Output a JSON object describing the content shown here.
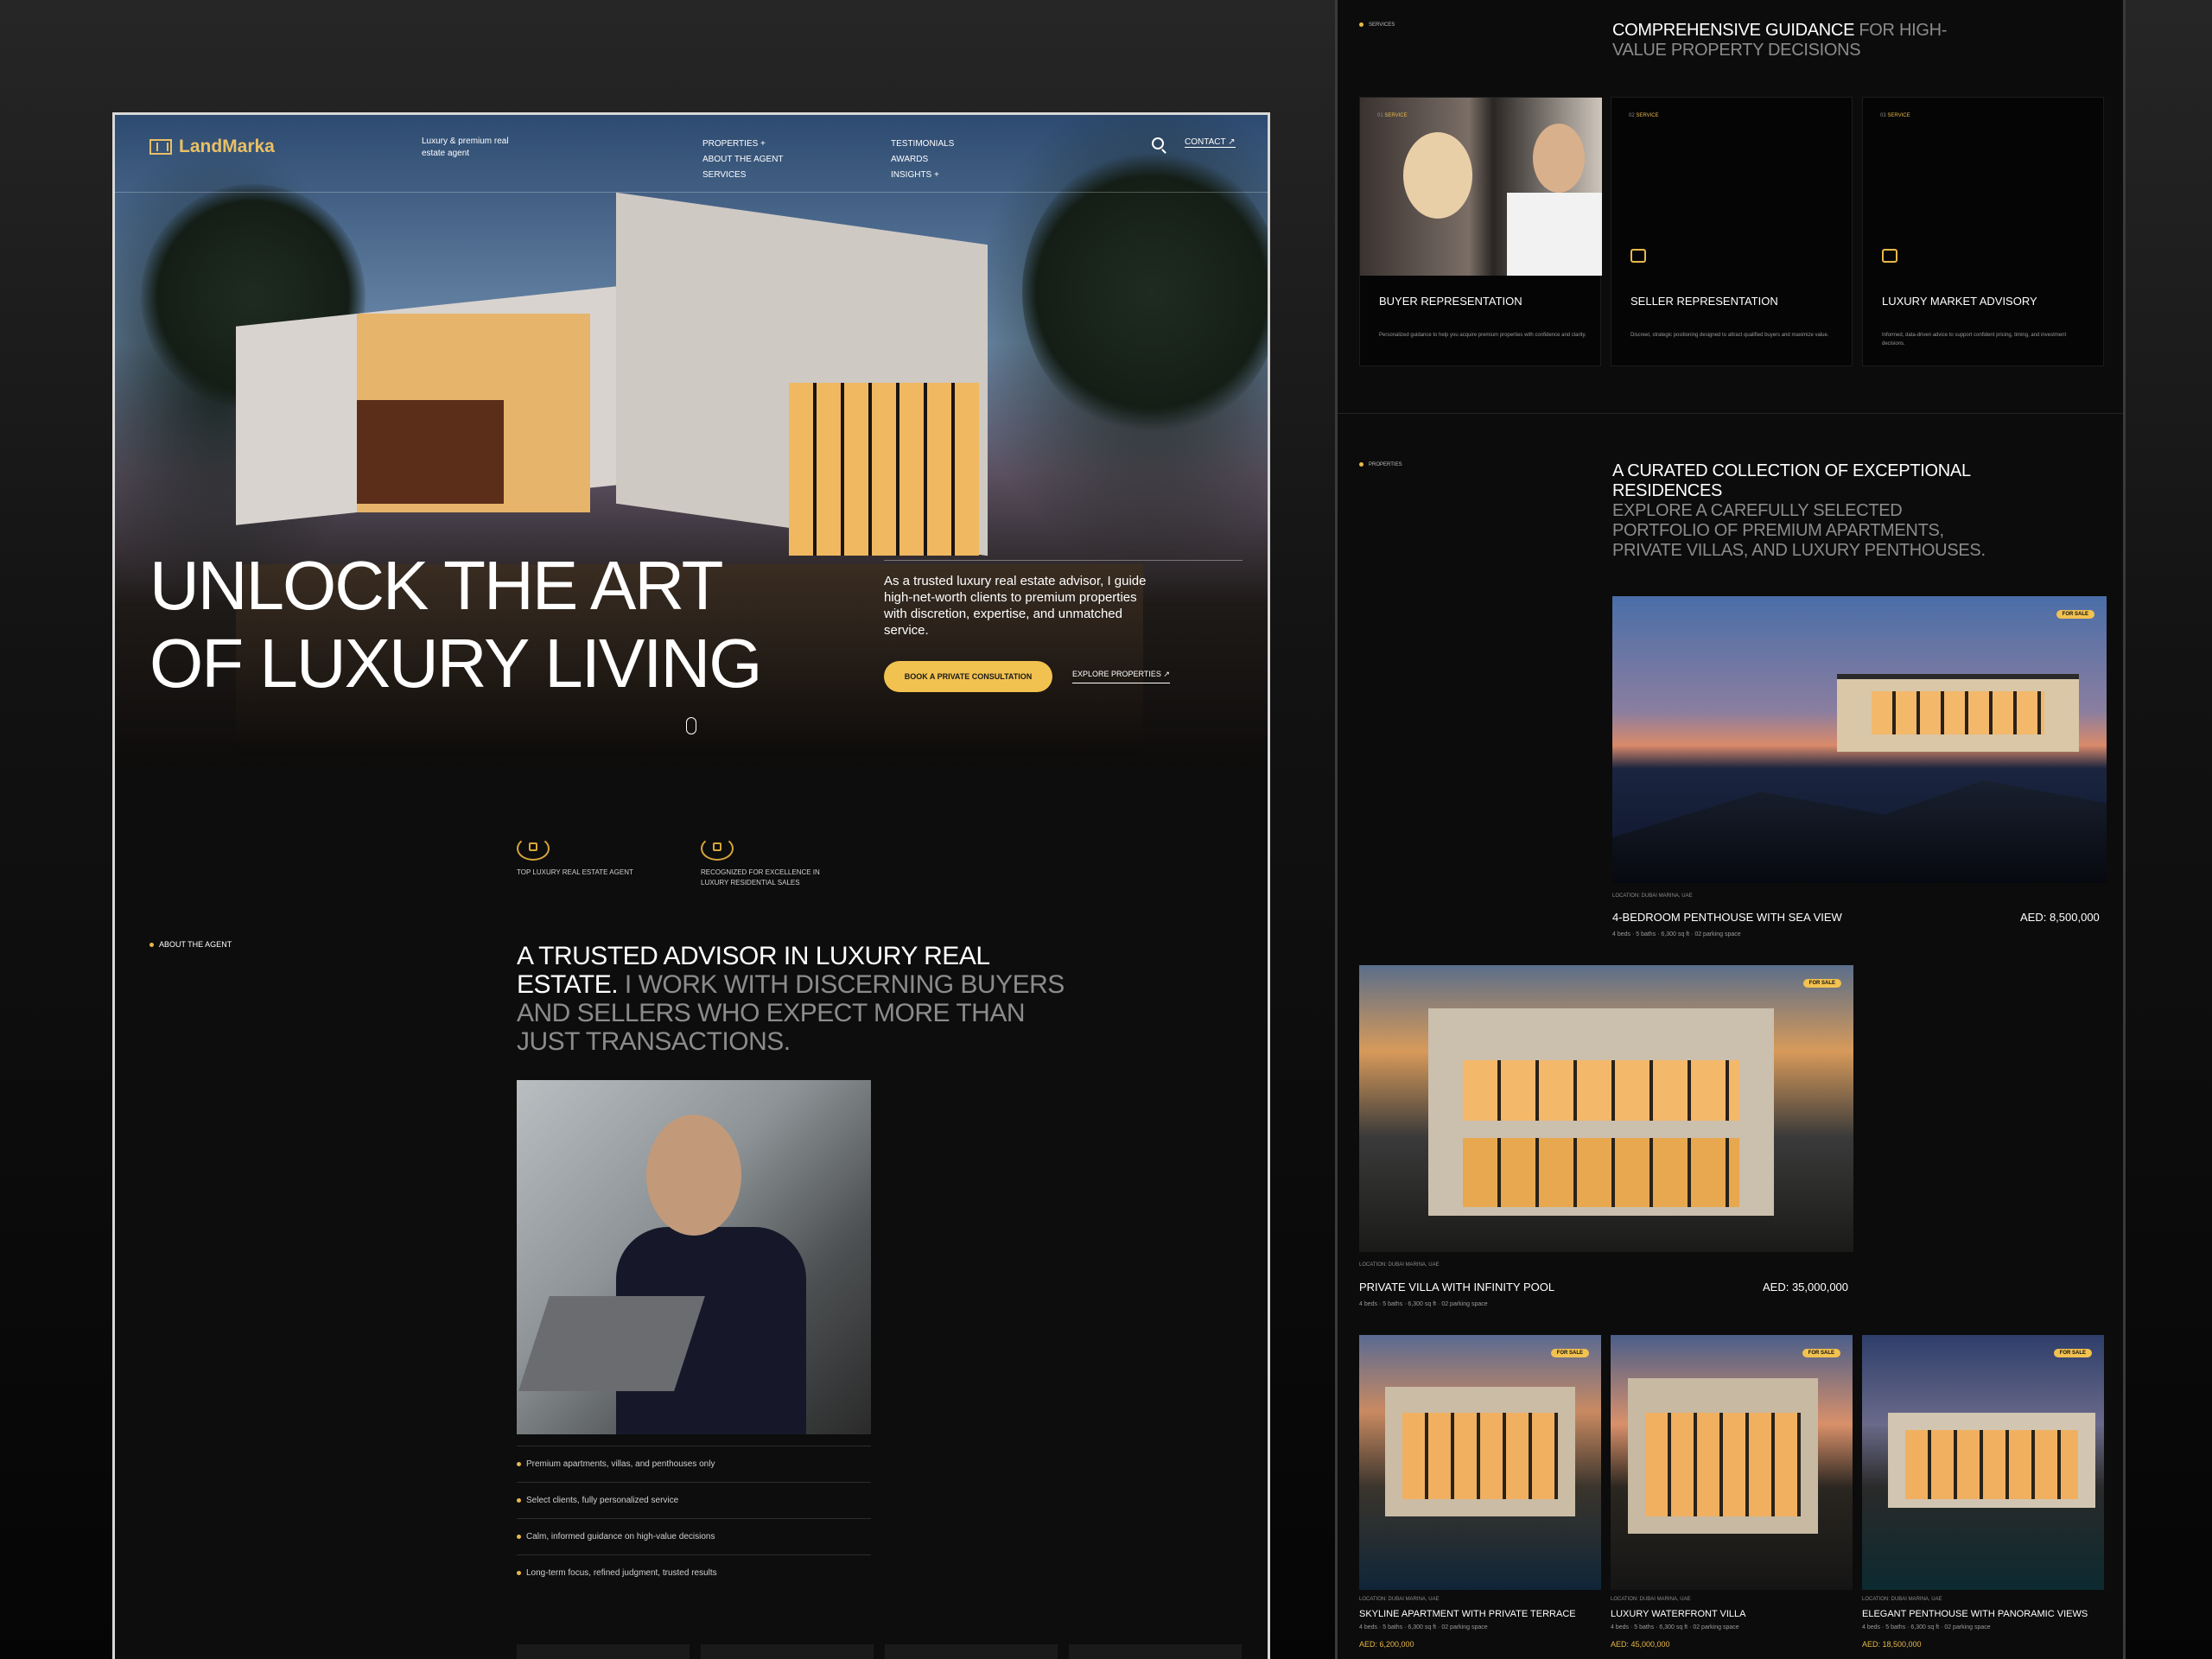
{
  "nav": {
    "logo": "LandMarka",
    "tagline": "Luxury & premium real estate agent",
    "col1": [
      "PROPERTIES +",
      "ABOUT THE AGENT",
      "SERVICES"
    ],
    "col2": [
      "TESTIMONIALS",
      "AWARDS",
      "INSIGHTS +"
    ],
    "contact": "CONTACT ↗"
  },
  "hero": {
    "title": "UNLOCK THE ART OF LUXURY LIVING",
    "text": "As a trusted luxury real estate advisor, I guide high-net-worth clients to premium properties with discretion, expertise, and unmatched service.",
    "cta": "BOOK A PRIVATE CONSULTATION",
    "explore": "EXPLORE PROPERTIES ↗"
  },
  "awards": [
    {
      "label": "TOP LUXURY REAL ESTATE AGENT"
    },
    {
      "label": "RECOGNIZED FOR EXCELLENCE IN LUXURY RESIDENTIAL SALES"
    }
  ],
  "about": {
    "section_label": "ABOUT THE AGENT",
    "heading_strong": "A TRUSTED ADVISOR IN LUXURY REAL ESTATE.",
    "heading_dim": " I WORK WITH DISCERNING BUYERS AND SELLERS WHO EXPECT MORE THAN JUST TRANSACTIONS.",
    "bullets": [
      "Premium apartments, villas, and penthouses only",
      "Select clients, fully personalized service",
      "Calm, informed guidance on high-value decisions",
      "Long-term focus, refined judgment, trusted results"
    ]
  },
  "services": {
    "section_label": "SERVICES",
    "heading_strong": "COMPREHENSIVE GUIDANCE",
    "heading_dim": " FOR HIGH-VALUE PROPERTY DECISIONS",
    "items": [
      {
        "num": "01",
        "kind": "SERVICE",
        "title": "BUYER REPRESENTATION",
        "desc": "Personalized guidance to help you acquire premium properties with confidence and clarity."
      },
      {
        "num": "02",
        "kind": "SERVICE",
        "title": "SELLER REPRESENTATION",
        "desc": "Discreet, strategic positioning designed to attract qualified buyers and maximize value."
      },
      {
        "num": "03",
        "kind": "SERVICE",
        "title": "LUXURY MARKET ADVISORY",
        "desc": "Informed, data-driven advice to support confident pricing, timing, and investment decisions."
      }
    ]
  },
  "properties": {
    "section_label": "PROPERTIES",
    "heading_strong": "A CURATED COLLECTION OF EXCEPTIONAL RESIDENCES",
    "heading_dim": "EXPLORE A CAREFULLY SELECTED PORTFOLIO OF PREMIUM APARTMENTS, PRIVATE VILLAS, AND LUXURY PENTHOUSES.",
    "badge": "FOR SALE",
    "location": "LOCATION: DUBAI MARINA, UAE",
    "items": [
      {
        "title": "4-BEDROOM PENTHOUSE WITH SEA VIEW",
        "price": "AED: 8,500,000",
        "meta": "4 beds · 5 baths · 6,300 sq ft · 02 parking space"
      },
      {
        "title": "PRIVATE VILLA WITH INFINITY POOL",
        "price": "AED: 35,000,000",
        "meta": "4 beds · 5 baths · 6,300 sq ft · 02 parking space"
      },
      {
        "title": "SKYLINE APARTMENT WITH PRIVATE TERRACE",
        "price": "AED: 6,200,000",
        "meta": "4 beds · 5 baths · 6,300 sq ft · 02 parking space"
      },
      {
        "title": "LUXURY WATERFRONT VILLA",
        "price": "AED: 45,000,000",
        "meta": "4 beds · 5 baths · 6,300 sq ft · 02 parking space"
      },
      {
        "title": "ELEGANT PENTHOUSE WITH PANORAMIC VIEWS",
        "price": "AED: 18,500,000",
        "meta": "4 beds · 5 baths · 6,300 sq ft · 02 parking space"
      }
    ]
  },
  "colors": {
    "accent": "#f2c250",
    "bg": "#0d0d0d"
  }
}
